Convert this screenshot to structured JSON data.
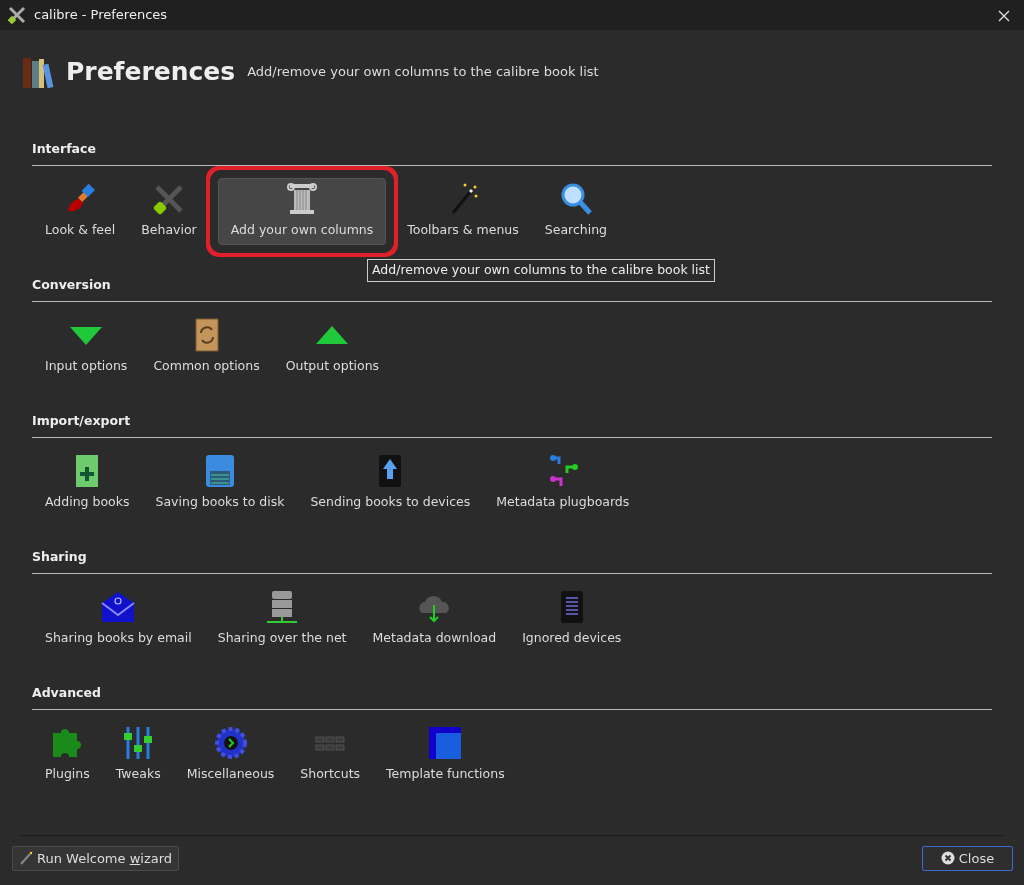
{
  "window": {
    "title": "calibre - Preferences"
  },
  "header": {
    "title": "Preferences",
    "description": "Add/remove your own columns to the calibre book list"
  },
  "sections": [
    {
      "title": "Interface",
      "items": [
        {
          "label": "Look & feel",
          "hovered": false
        },
        {
          "label": "Behavior",
          "hovered": false
        },
        {
          "label": "Add your own columns",
          "hovered": true
        },
        {
          "label": "Toolbars & menus",
          "hovered": false
        },
        {
          "label": "Searching",
          "hovered": false
        }
      ]
    },
    {
      "title": "Conversion",
      "items": [
        {
          "label": "Input options",
          "hovered": false
        },
        {
          "label": "Common options",
          "hovered": false
        },
        {
          "label": "Output options",
          "hovered": false
        }
      ]
    },
    {
      "title": "Import/export",
      "items": [
        {
          "label": "Adding books",
          "hovered": false
        },
        {
          "label": "Saving books to disk",
          "hovered": false
        },
        {
          "label": "Sending books to devices",
          "hovered": false
        },
        {
          "label": "Metadata plugboards",
          "hovered": false
        }
      ]
    },
    {
      "title": "Sharing",
      "items": [
        {
          "label": "Sharing books by email",
          "hovered": false
        },
        {
          "label": "Sharing over the net",
          "hovered": false
        },
        {
          "label": "Metadata download",
          "hovered": false
        },
        {
          "label": "Ignored devices",
          "hovered": false
        }
      ]
    },
    {
      "title": "Advanced",
      "items": [
        {
          "label": "Plugins",
          "hovered": false
        },
        {
          "label": "Tweaks",
          "hovered": false
        },
        {
          "label": "Miscellaneous",
          "hovered": false
        },
        {
          "label": "Shortcuts",
          "hovered": false
        },
        {
          "label": "Template functions",
          "hovered": false
        }
      ]
    }
  ],
  "tooltip": "Add/remove your own columns to the calibre book list",
  "footer": {
    "wizard_button": {
      "label_before": "Run Welcome ",
      "mnemonic": "w",
      "label_after": "izard"
    },
    "close_button": "Close"
  }
}
